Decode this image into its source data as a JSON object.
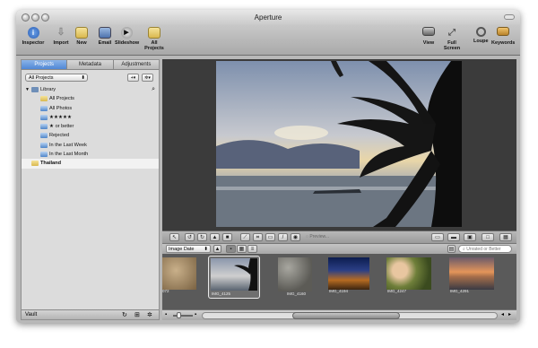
{
  "window": {
    "title": "Aperture"
  },
  "toolbar": {
    "inspector": "Inspector",
    "import": "Import",
    "new": "New",
    "email": "Email",
    "slideshow": "Slideshow",
    "all_projects": "All Projects",
    "view": "View",
    "full_screen": "Full Screen",
    "loupe": "Loupe",
    "keywords": "Keywords"
  },
  "sidebar": {
    "tabs": [
      "Projects",
      "Metadata",
      "Adjustments"
    ],
    "project_filter": "All Projects",
    "filter_icon": "⌕",
    "library_label": "Library",
    "items": [
      {
        "label": "All Projects",
        "icon": "folder-icon"
      },
      {
        "label": "All Photos",
        "icon": "smart-album-icon"
      },
      {
        "label": "★★★★★",
        "icon": "smart-album-icon"
      },
      {
        "label": "★ or better",
        "icon": "smart-album-icon"
      },
      {
        "label": "Rejected",
        "icon": "smart-album-icon"
      },
      {
        "label": "In the Last Week",
        "icon": "smart-album-icon"
      },
      {
        "label": "In the Last Month",
        "icon": "smart-album-icon"
      }
    ],
    "project": "Thailand",
    "footer": "Vault"
  },
  "browser": {
    "sort": "Image Date",
    "search_placeholder": "Unrated or Better",
    "preview_label": "Preview...",
    "thumbs": [
      {
        "name": "072"
      },
      {
        "name": "IMG_4125"
      },
      {
        "name": "IMG_4160"
      },
      {
        "name": "IMG_4194"
      },
      {
        "name": "IMG_4247"
      },
      {
        "name": "IMG_4291"
      }
    ]
  },
  "colors": {
    "accent": "#5088d6",
    "viewer_bg": "#3b3b3b",
    "browser_bg": "#5a5a5a"
  }
}
